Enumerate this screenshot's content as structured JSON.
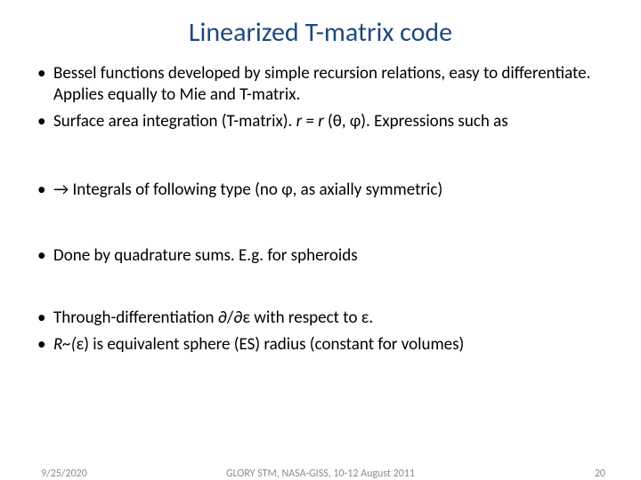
{
  "title": "Linearized T-matrix code",
  "bullets": {
    "b1": "Bessel functions developed by simple recursion relations, easy to differentiate. Applies equally to Mie and T-matrix.",
    "b2_pre": "Surface area integration (T-matrix). ",
    "b2_r": "r = r ",
    "b2_paren": "(θ, φ). ",
    "b2_post": "Expressions such as",
    "b3_pre": "→ Integrals of following type (no ",
    "b3_phi": "φ",
    "b3_post": ", as axially symmetric)",
    "b4": "Done by quadrature sums. E.g. for spheroids",
    "b5_pre": "Through-differentiation ",
    "b5_mid": "∂/∂ε",
    "b5_mid2": "  with respect to ",
    "b5_eps": "ε.",
    "b6_pre": "R~(",
    "b6_eps": "ε",
    "b6_post": ") is equivalent  sphere (ES) radius (constant for volumes)"
  },
  "footer": {
    "date": "9/25/2020",
    "center": "GLORY STM, NASA-GISS, 10-12 August 2011",
    "page": "20"
  }
}
